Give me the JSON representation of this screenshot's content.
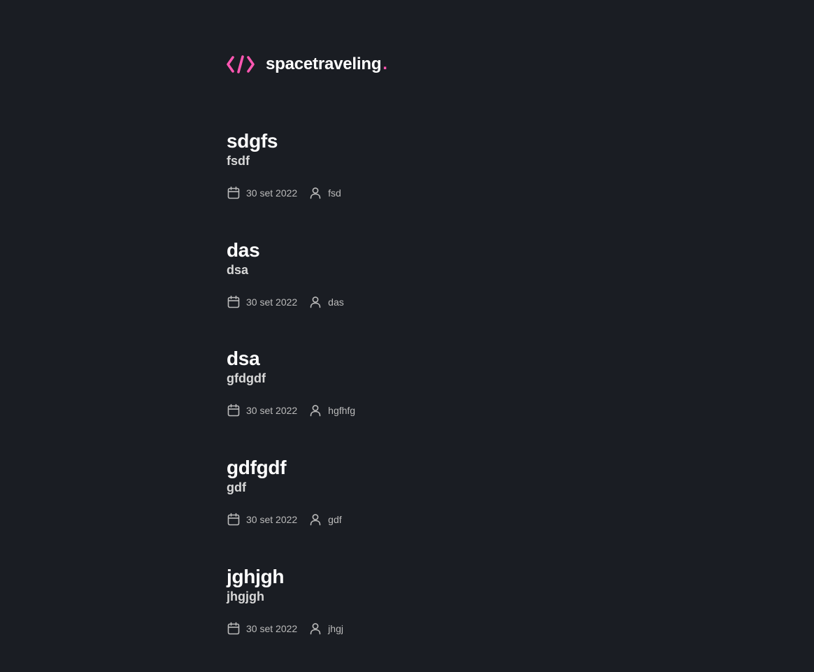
{
  "header": {
    "logo_icon": "code-brackets-icon",
    "brand": "spacetraveling",
    "brand_dot": ".",
    "accent_color": "#ff57b2"
  },
  "posts": [
    {
      "title": "sdgfs",
      "subtitle": "fsdf",
      "date": "30 set 2022",
      "author": "fsd"
    },
    {
      "title": "das",
      "subtitle": "dsa",
      "date": "30 set 2022",
      "author": "das"
    },
    {
      "title": "dsa",
      "subtitle": "gfdgdf",
      "date": "30 set 2022",
      "author": "hgfhfg"
    },
    {
      "title": "gdfgdf",
      "subtitle": "gdf",
      "date": "30 set 2022",
      "author": "gdf"
    },
    {
      "title": "jghjgh",
      "subtitle": "jhgjgh",
      "date": "30 set 2022",
      "author": "jhgj"
    }
  ],
  "icons": {
    "date": "calendar-icon",
    "author": "user-icon"
  },
  "colors": {
    "background": "#1a1d23",
    "heading": "#ffffff",
    "subtitle": "#d7d7d7",
    "info": "#bbbbbb"
  }
}
